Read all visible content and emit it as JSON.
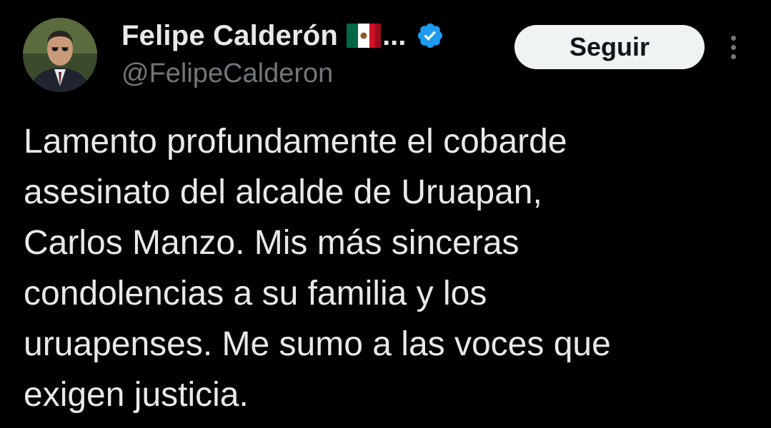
{
  "author": {
    "display_name": "Felipe Calderón",
    "name_truncation": "...",
    "flag_emoji": "mexico-flag-icon",
    "verified": true,
    "handle": "@FelipeCalderon"
  },
  "actions": {
    "follow_label": "Seguir",
    "more_icon": "more-vertical-icon"
  },
  "tweet": {
    "text": "Lamento profundamente el cobarde\nasesinato del alcalde de Uruapan,\nCarlos Manzo. Mis más sinceras\ncondolencias a su familia y los\nuruapenses.  Me sumo a las voces que\nexigen justicia."
  },
  "colors": {
    "background": "#000000",
    "primary_text": "#e7e9ea",
    "secondary_text": "#71767b",
    "verified_blue": "#1d9bf0",
    "follow_button_bg": "#eff3f4"
  }
}
